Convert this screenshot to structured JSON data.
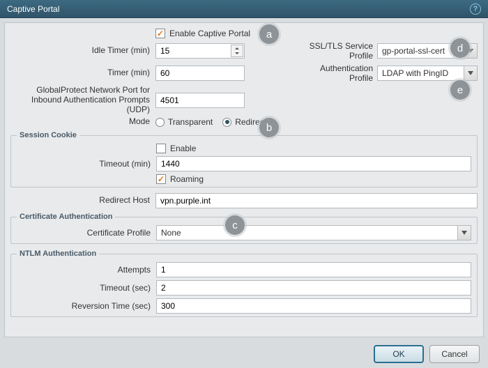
{
  "title": "Captive Portal",
  "enable_label": "Enable Captive Portal",
  "enable_checked": true,
  "left_fields": {
    "idle_timer_label": "Idle Timer (min)",
    "idle_timer_value": "15",
    "timer_label": "Timer (min)",
    "timer_value": "60",
    "gp_port_label": "GlobalProtect Network Port for Inbound Authentication Prompts (UDP)",
    "gp_port_value": "4501",
    "mode_label": "Mode",
    "mode_transparent": "Transparent",
    "mode_redirect": "Redirect"
  },
  "right_fields": {
    "ssl_profile_label": "SSL/TLS Service Profile",
    "ssl_profile_value": "gp-portal-ssl-cert",
    "auth_profile_label": "Authentication Profile",
    "auth_profile_value": "LDAP with PingID"
  },
  "session_cookie": {
    "legend": "Session Cookie",
    "enable_label": "Enable",
    "enable_checked": false,
    "timeout_label": "Timeout (min)",
    "timeout_value": "1440",
    "roaming_label": "Roaming",
    "roaming_checked": true
  },
  "redirect_host_label": "Redirect Host",
  "redirect_host_value": "vpn.purple.int",
  "cert_auth": {
    "legend": "Certificate Authentication",
    "cert_profile_label": "Certificate Profile",
    "cert_profile_value": "None"
  },
  "ntlm": {
    "legend": "NTLM Authentication",
    "attempts_label": "Attempts",
    "attempts_value": "1",
    "timeout_label": "Timeout (sec)",
    "timeout_value": "2",
    "reversion_label": "Reversion Time (sec)",
    "reversion_value": "300"
  },
  "buttons": {
    "ok": "OK",
    "cancel": "Cancel"
  },
  "callouts": {
    "a": "a",
    "b": "b",
    "c": "c",
    "d": "d",
    "e": "e"
  }
}
